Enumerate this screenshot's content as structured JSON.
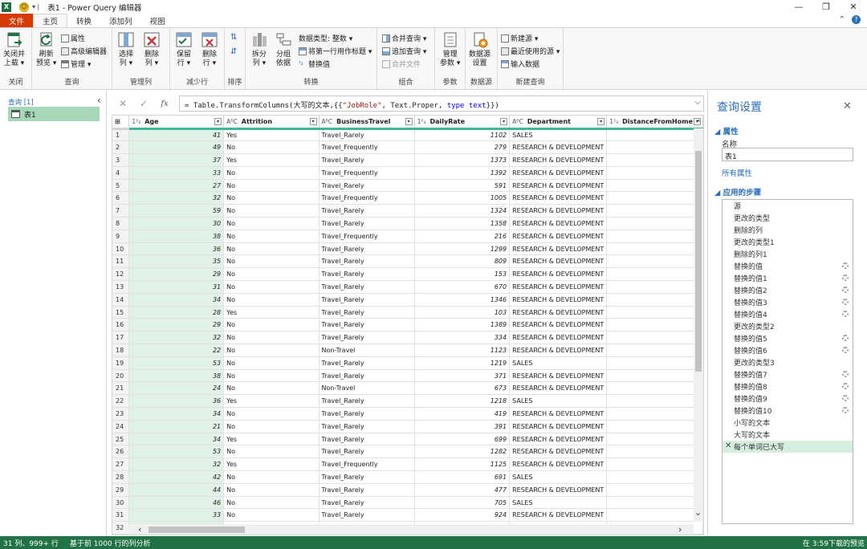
{
  "titlebar": {
    "sep": "▾ |",
    "title": "表1 - Power Query 编辑器",
    "minimize": "—",
    "restore": "❐",
    "close": "✕"
  },
  "tabs": [
    "文件",
    "主页",
    "转换",
    "添加列",
    "视图"
  ],
  "ribbon": {
    "close_group": {
      "btn": "关闭并上载",
      "btn_l1": "关闭并",
      "btn_l2": "上载 ▾",
      "name": "关闭"
    },
    "query_group": {
      "refresh_l1": "刷新",
      "refresh_l2": "预览 ▾",
      "properties": "属性",
      "advanced": "高级编辑器",
      "manage": "管理 ▾",
      "name": "查询"
    },
    "manage_cols": {
      "choose_l1": "选择",
      "choose_l2": "列 ▾",
      "remove_l1": "删除",
      "remove_l2": "列 ▾",
      "name": "管理列"
    },
    "reduce_rows": {
      "keep_l1": "保留",
      "keep_l2": "行 ▾",
      "remove_l1": "删除",
      "remove_l2": "行 ▾",
      "name": "减少行"
    },
    "sort": {
      "name": "排序"
    },
    "transform": {
      "split_l1": "拆分",
      "split_l2": "列 ▾",
      "group_l1": "分组",
      "group_l2": "依据",
      "datatype": "数据类型: 整数 ▾",
      "first_row": "将第一行用作标题 ▾",
      "replace": "替换值",
      "name": "转换"
    },
    "combine": {
      "merge": "合并查询 ▾",
      "append": "追加查询 ▾",
      "combine_files": "合并文件",
      "name": "组合"
    },
    "params": {
      "manage_l1": "管理",
      "manage_l2": "参数 ▾",
      "name": "参数"
    },
    "datasource": {
      "btn_l1": "数据源",
      "btn_l2": "设置",
      "name": "数据源"
    },
    "newquery": {
      "new_source": "新建源 ▾",
      "recent": "最近使用的源 ▾",
      "enter": "输入数据",
      "name": "新建查询"
    }
  },
  "left_panel": {
    "label": "查询 [1]",
    "collapse": "‹",
    "query": "表1"
  },
  "formula": {
    "prefix": "= Table.TransformColumns(大写的文本,{{",
    "str": "\"JobRole\"",
    "mid": ", Text.Proper, ",
    "kw": "type",
    "kw2": "text",
    "suffix": "}})",
    "cancel": "✕",
    "confirm": "✓",
    "fx": "fx",
    "dd": "⌵"
  },
  "columns": [
    {
      "type": "1²₃",
      "name": "Age"
    },
    {
      "type": "AᴮC",
      "name": "Attrition"
    },
    {
      "type": "AᴮC",
      "name": "BusinessTravel"
    },
    {
      "type": "1²₃",
      "name": "DailyRate"
    },
    {
      "type": "AᴮC",
      "name": "Department"
    },
    {
      "type": "1²₃",
      "name": "DistanceFromHome"
    }
  ],
  "rows": [
    [
      1,
      41,
      "Yes",
      "Travel_Rarely",
      1102,
      "SALES"
    ],
    [
      2,
      49,
      "No",
      "Travel_Frequently",
      279,
      "RESEARCH & DEVELOPMENT"
    ],
    [
      3,
      37,
      "Yes",
      "Travel_Rarely",
      1373,
      "RESEARCH & DEVELOPMENT"
    ],
    [
      4,
      33,
      "No",
      "Travel_Frequently",
      1392,
      "RESEARCH & DEVELOPMENT"
    ],
    [
      5,
      27,
      "No",
      "Travel_Rarely",
      591,
      "RESEARCH & DEVELOPMENT"
    ],
    [
      6,
      32,
      "No",
      "Travel_Frequently",
      1005,
      "RESEARCH & DEVELOPMENT"
    ],
    [
      7,
      59,
      "No",
      "Travel_Rarely",
      1324,
      "RESEARCH & DEVELOPMENT"
    ],
    [
      8,
      30,
      "No",
      "Travel_Rarely",
      1358,
      "RESEARCH & DEVELOPMENT"
    ],
    [
      9,
      38,
      "No",
      "Travel_Frequently",
      216,
      "RESEARCH & DEVELOPMENT"
    ],
    [
      10,
      36,
      "No",
      "Travel_Rarely",
      1299,
      "RESEARCH & DEVELOPMENT"
    ],
    [
      11,
      35,
      "No",
      "Travel_Rarely",
      809,
      "RESEARCH & DEVELOPMENT"
    ],
    [
      12,
      29,
      "No",
      "Travel_Rarely",
      153,
      "RESEARCH & DEVELOPMENT"
    ],
    [
      13,
      31,
      "No",
      "Travel_Rarely",
      670,
      "RESEARCH & DEVELOPMENT"
    ],
    [
      14,
      34,
      "No",
      "Travel_Rarely",
      1346,
      "RESEARCH & DEVELOPMENT"
    ],
    [
      15,
      28,
      "Yes",
      "Travel_Rarely",
      103,
      "RESEARCH & DEVELOPMENT"
    ],
    [
      16,
      29,
      "No",
      "Travel_Rarely",
      1389,
      "RESEARCH & DEVELOPMENT"
    ],
    [
      17,
      32,
      "No",
      "Travel_Rarely",
      334,
      "RESEARCH & DEVELOPMENT"
    ],
    [
      18,
      22,
      "No",
      "Non-Travel",
      1123,
      "RESEARCH & DEVELOPMENT"
    ],
    [
      19,
      53,
      "No",
      "Travel_Rarely",
      1219,
      "SALES"
    ],
    [
      20,
      38,
      "No",
      "Travel_Rarely",
      371,
      "RESEARCH & DEVELOPMENT"
    ],
    [
      21,
      24,
      "No",
      "Non-Travel",
      673,
      "RESEARCH & DEVELOPMENT"
    ],
    [
      22,
      36,
      "Yes",
      "Travel_Rarely",
      1218,
      "SALES"
    ],
    [
      23,
      34,
      "No",
      "Travel_Rarely",
      419,
      "RESEARCH & DEVELOPMENT"
    ],
    [
      24,
      21,
      "No",
      "Travel_Rarely",
      391,
      "RESEARCH & DEVELOPMENT"
    ],
    [
      25,
      34,
      "Yes",
      "Travel_Rarely",
      699,
      "RESEARCH & DEVELOPMENT"
    ],
    [
      26,
      53,
      "No",
      "Travel_Rarely",
      1282,
      "RESEARCH & DEVELOPMENT"
    ],
    [
      27,
      32,
      "Yes",
      "Travel_Frequently",
      1125,
      "RESEARCH & DEVELOPMENT"
    ],
    [
      28,
      42,
      "No",
      "Travel_Rarely",
      691,
      "SALES"
    ],
    [
      29,
      44,
      "No",
      "Travel_Rarely",
      477,
      "RESEARCH & DEVELOPMENT"
    ],
    [
      30,
      46,
      "No",
      "Travel_Rarely",
      705,
      "SALES"
    ],
    [
      31,
      33,
      "No",
      "Travel_Rarely",
      924,
      "RESEARCH & DEVELOPMENT"
    ],
    [
      32,
      "",
      "",
      "",
      "",
      ""
    ]
  ],
  "settings": {
    "title": "查询设置",
    "close": "✕",
    "props_header": "◢ 属性",
    "name_label": "名称",
    "name_value": "表1",
    "all_props": "所有属性",
    "steps_header": "◢ 应用的步骤",
    "steps": [
      {
        "label": "源",
        "gear": false
      },
      {
        "label": "更改的类型",
        "gear": false
      },
      {
        "label": "删除的列",
        "gear": false
      },
      {
        "label": "更改的类型1",
        "gear": false
      },
      {
        "label": "删除的列1",
        "gear": false
      },
      {
        "label": "替换的值",
        "gear": true
      },
      {
        "label": "替换的值1",
        "gear": true
      },
      {
        "label": "替换的值2",
        "gear": true
      },
      {
        "label": "替换的值3",
        "gear": true
      },
      {
        "label": "替换的值4",
        "gear": true
      },
      {
        "label": "更改的类型2",
        "gear": false
      },
      {
        "label": "替换的值5",
        "gear": true
      },
      {
        "label": "替换的值6",
        "gear": true
      },
      {
        "label": "更改的类型3",
        "gear": false
      },
      {
        "label": "替换的值7",
        "gear": true
      },
      {
        "label": "替换的值8",
        "gear": true
      },
      {
        "label": "替换的值9",
        "gear": true
      },
      {
        "label": "替换的值10",
        "gear": true
      },
      {
        "label": "小写的文本",
        "gear": false
      },
      {
        "label": "大写的文本",
        "gear": false
      },
      {
        "label": "每个单词已大写",
        "gear": false,
        "selected": true,
        "delete": "✕"
      }
    ]
  },
  "status": {
    "cols_rows": "31 列、999+ 行",
    "profile": "基于前 1000 行的列分析",
    "download": "在 3:59下载的预览"
  },
  "colors": {
    "accent": "#217346",
    "file_tab": "#d83b01",
    "link": "#2a6fbb",
    "selected_col": "#dff2e5"
  }
}
